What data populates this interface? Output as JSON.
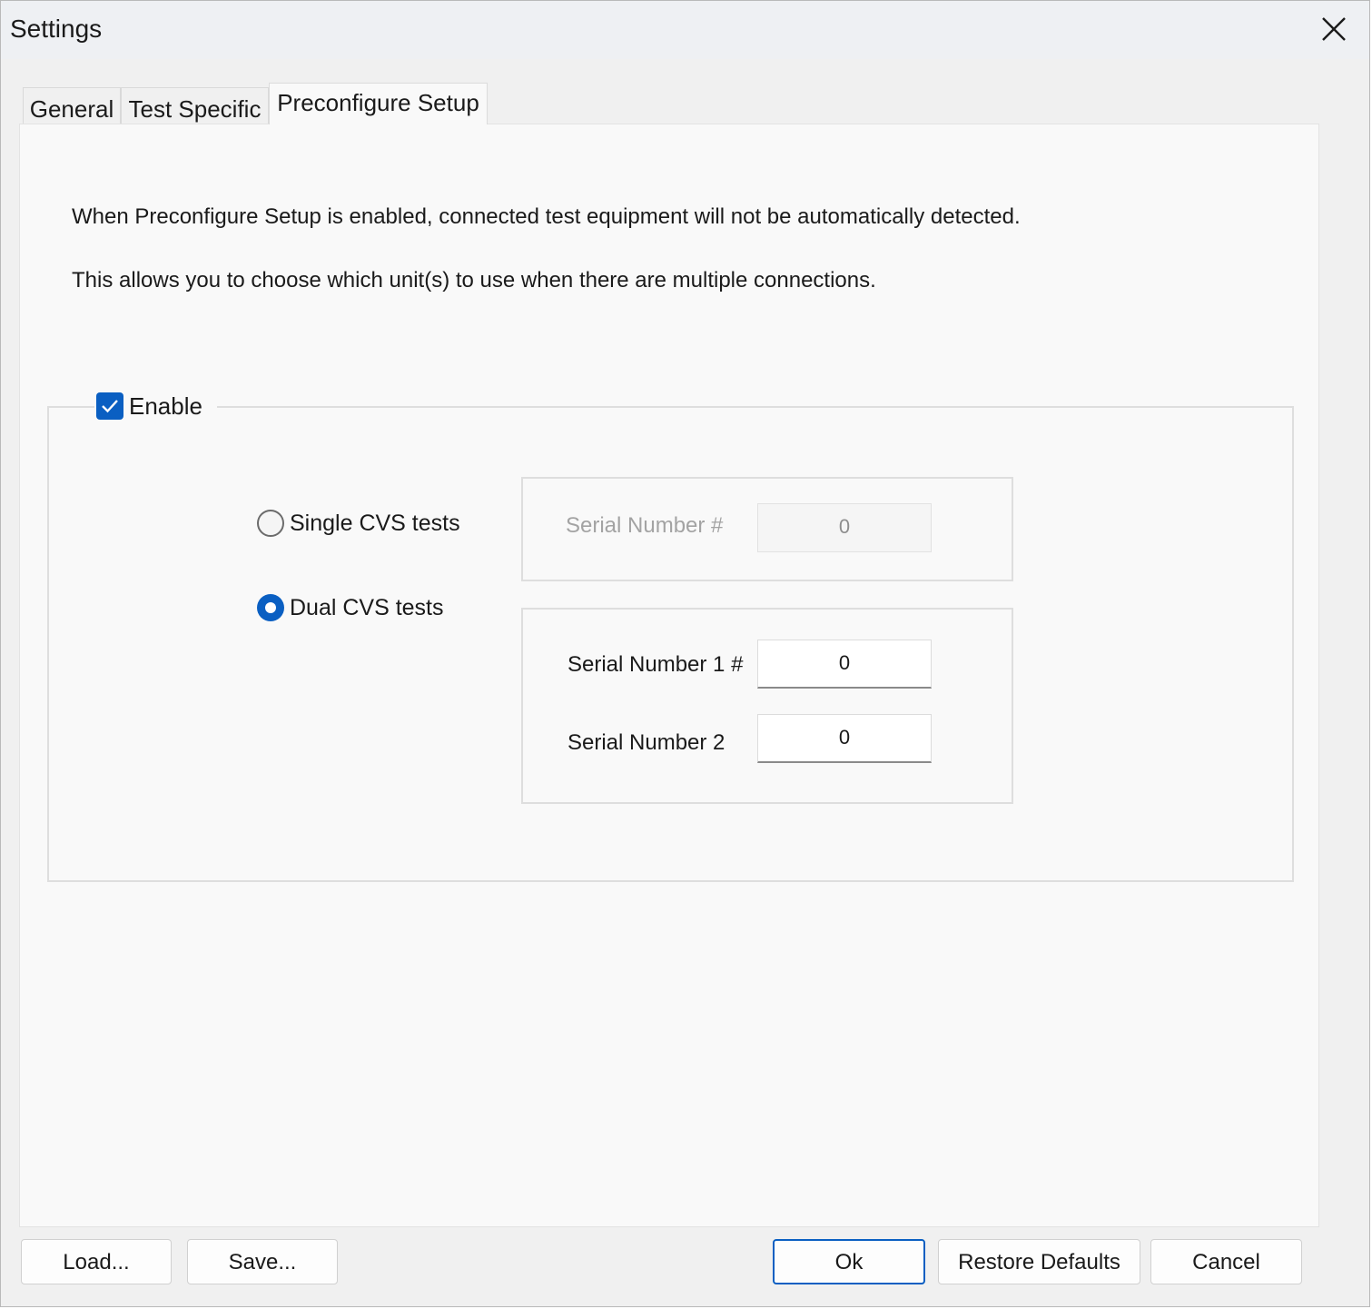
{
  "window": {
    "title": "Settings"
  },
  "tabs": [
    {
      "label": "General",
      "active": false
    },
    {
      "label": "Test Specific",
      "active": false
    },
    {
      "label": "Preconfigure Setup",
      "active": true
    }
  ],
  "panel": {
    "description_1": "When Preconfigure Setup is enabled, connected test equipment will not be automatically detected.",
    "description_2": "This allows you to choose which unit(s) to use when there are multiple connections.",
    "enable": {
      "label": "Enable",
      "checked": true
    },
    "options": {
      "single": {
        "label": "Single CVS tests",
        "selected": false,
        "serial_label": "Serial Number #",
        "serial_value": "0"
      },
      "dual": {
        "label": "Dual CVS tests",
        "selected": true,
        "serial1_label": "Serial Number 1 #",
        "serial1_value": "0",
        "serial2_label": "Serial Number 2",
        "serial2_value": "0"
      }
    }
  },
  "footer": {
    "load_label": "Load...",
    "save_label": "Save...",
    "ok_label": "Ok",
    "restore_label": "Restore Defaults",
    "cancel_label": "Cancel"
  },
  "colors": {
    "accent": "#0a5fc2",
    "panel_background": "#f9f9f9",
    "window_background": "#f0f0f0",
    "disabled_text": "#a3a3a3"
  },
  "icons": {
    "close": "close-icon",
    "checkbox": "checkmark-icon"
  }
}
